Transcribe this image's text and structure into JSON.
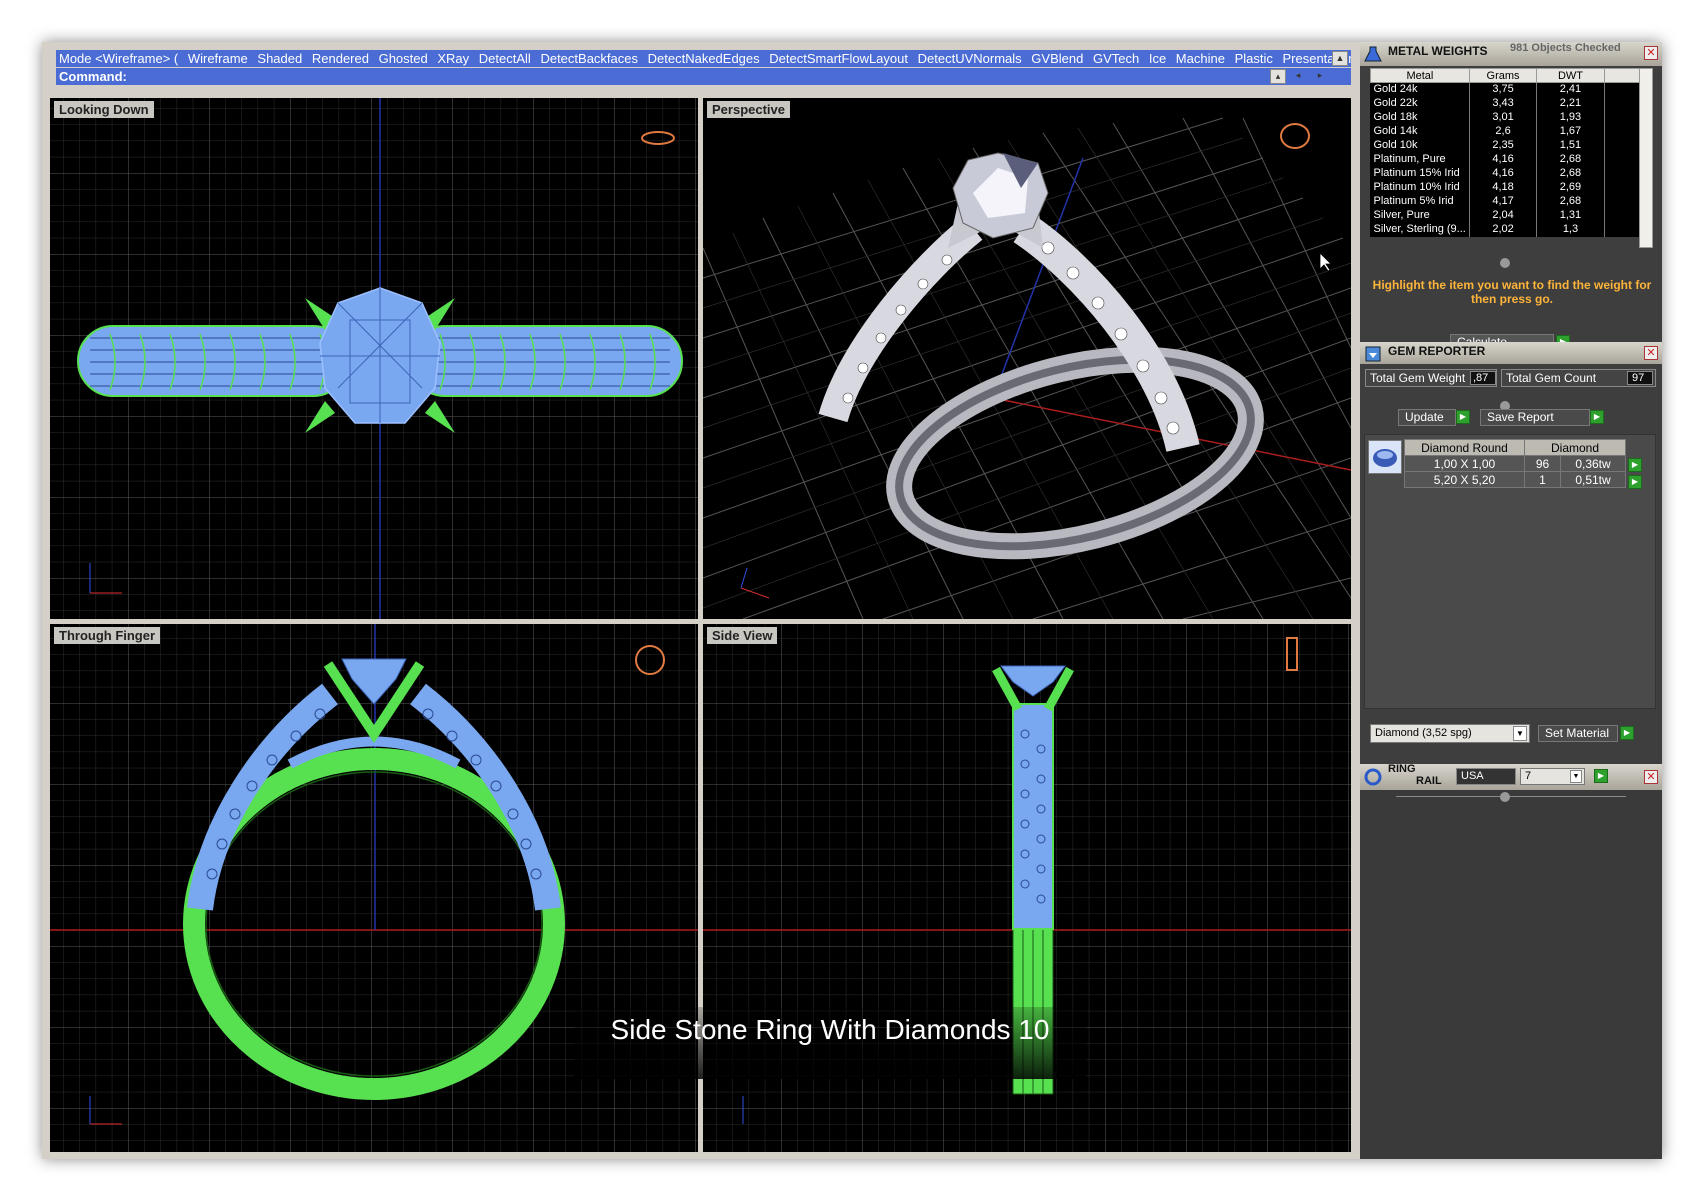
{
  "mode_bar": {
    "items": [
      "Mode <Wireframe> (",
      "Wireframe",
      "Shaded",
      "Rendered",
      "Ghosted",
      "XRay",
      "DetectAll",
      "DetectBackfaces",
      "DetectNakedEdges",
      "DetectSmartFlowLayout",
      "DetectUVNormals",
      "GVBlend",
      "GVTech",
      "Ice",
      "Machine",
      "Plastic",
      "Presentation",
      "S"
    ]
  },
  "command_bar": {
    "label": "Command:"
  },
  "viewports": {
    "top_left": "Looking Down",
    "top_right": "Perspective",
    "bottom_left": "Through Finger",
    "bottom_right": "Side View"
  },
  "metal_weights": {
    "title": "METAL WEIGHTS",
    "status": "981 Objects Checked",
    "columns": [
      "Metal",
      "Grams",
      "DWT"
    ],
    "rows": [
      [
        "Gold 24k",
        "3,75",
        "2,41"
      ],
      [
        "Gold 22k",
        "3,43",
        "2,21"
      ],
      [
        "Gold 18k",
        "3,01",
        "1,93"
      ],
      [
        "Gold 14k",
        "2,6",
        "1,67"
      ],
      [
        "Gold 10k",
        "2,35",
        "1,51"
      ],
      [
        "Platinum, Pure",
        "4,16",
        "2,68"
      ],
      [
        "Platinum 15% Irid",
        "4,16",
        "2,68"
      ],
      [
        "Platinum 10% Irid",
        "4,18",
        "2,69"
      ],
      [
        "Platinum 5% Irid",
        "4,17",
        "2,68"
      ],
      [
        "Silver, Pure",
        "2,04",
        "1,31"
      ],
      [
        "Silver, Sterling (9...",
        "2,02",
        "1,3"
      ]
    ],
    "note": "Highlight the item you want to find the weight for then press go.",
    "calculate_label": "Calculate"
  },
  "gem_reporter": {
    "title": "GEM REPORTER",
    "total_weight_label": "Total Gem Weight",
    "total_weight_value": ",87",
    "total_count_label": "Total Gem Count",
    "total_count_value": "97",
    "update_label": "Update",
    "save_label": "Save Report",
    "table_headers": [
      "Diamond Round",
      "Diamond"
    ],
    "table_rows": [
      [
        "1,00 X 1,00",
        "96",
        "0,36tw"
      ],
      [
        "5,20 X 5,20",
        "1",
        "0,51tw"
      ]
    ],
    "material_select": "Diamond    (3,52 spg)",
    "set_material_label": "Set Material"
  },
  "ring_rail": {
    "title_line1": "RING",
    "title_line2": "RAIL",
    "country": "USA",
    "size": "7"
  },
  "caption": "Side Stone Ring With Diamonds 10",
  "colors": {
    "accent_blue": "#4a6cd4",
    "wire_green": "#57e04f",
    "wire_blue": "#7aa8f0",
    "panel_dark": "#3a3a3a",
    "note_orange": "#ffb43a"
  }
}
